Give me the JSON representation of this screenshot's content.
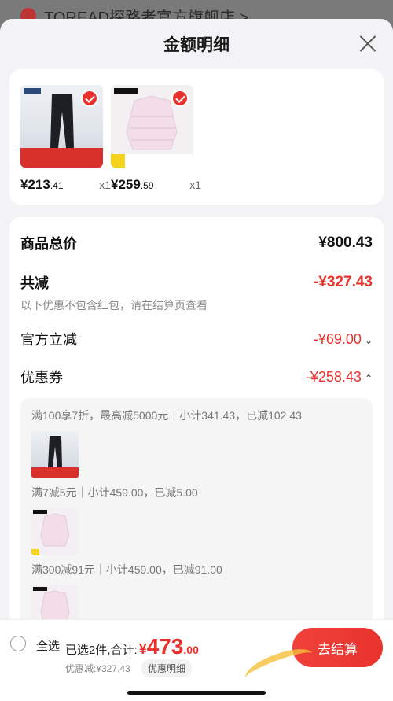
{
  "background": {
    "store_name": "TOREAD探路者官方旗舰店 >"
  },
  "sheet": {
    "title": "金额明细"
  },
  "products": [
    {
      "price_int": "¥213",
      "price_dec": ".41",
      "qty": "x1",
      "type": "pants"
    },
    {
      "price_int": "¥259",
      "price_dec": ".59",
      "qty": "x1",
      "type": "jacket"
    }
  ],
  "summary": {
    "total_label": "商品总价",
    "total_value": "¥800.43",
    "reduce_label": "共减",
    "reduce_value": "-¥327.43",
    "reduce_note": "以下优惠不包含红包，请在结算页查看",
    "official_label": "官方立减",
    "official_value": "-¥69.00",
    "coupon_label": "优惠券",
    "coupon_value": "-¥258.43"
  },
  "coupons": [
    {
      "text": "满100享7折，最高减5000元｜小计341.43，已减102.43",
      "thumb": "pants"
    },
    {
      "text": "满7减5元｜小计459.00，已减5.00",
      "thumb": "jacket"
    },
    {
      "text": "满300减91元｜小计459.00，已减91.00",
      "thumb": "jacket"
    }
  ],
  "bottom": {
    "select_all": "全选",
    "selected_prefix": "已选2件,合计:",
    "total_symbol": "¥",
    "total_int": "473",
    "total_dec": ".00",
    "saved": "优惠减:¥327.43",
    "detail": "优惠明细",
    "pay": "去结算"
  },
  "colors": {
    "accent": "#e8322d"
  }
}
